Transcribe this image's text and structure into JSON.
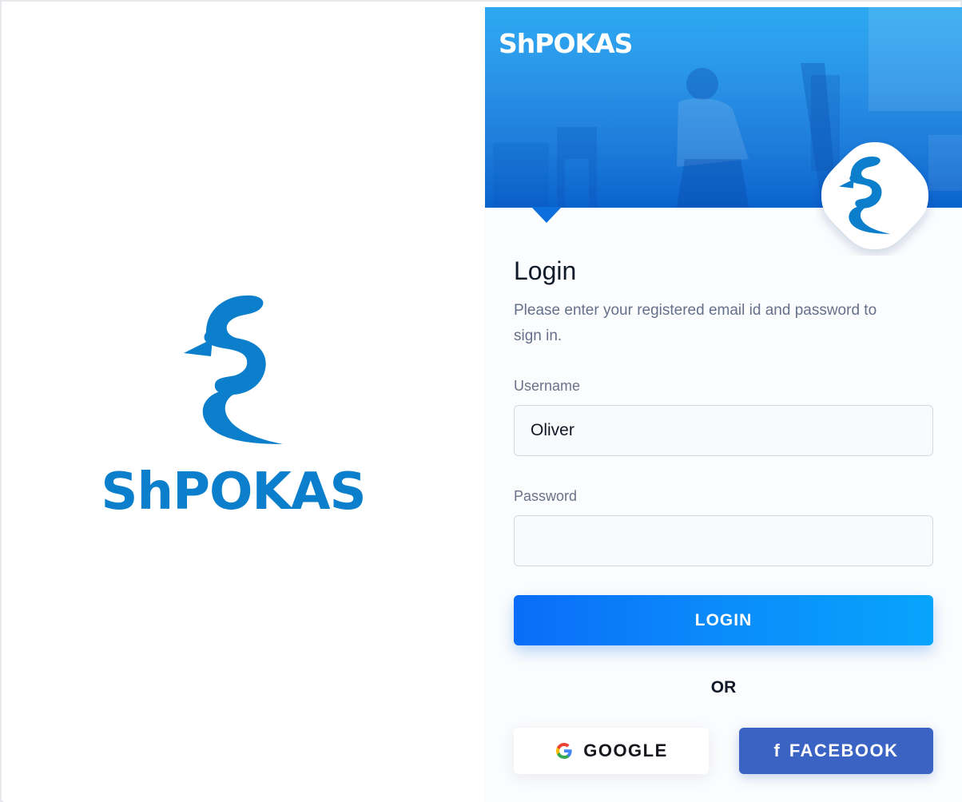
{
  "brand": {
    "name": "ShPOKAS",
    "color": "#0b7fcb"
  },
  "hero": {
    "wordmark": "ShPOKAS"
  },
  "login": {
    "title": "Login",
    "description": "Please enter your registered email id and password to sign in.",
    "username_label": "Username",
    "username_value": "Oliver",
    "password_label": "Password",
    "password_value": "",
    "submit_label": "LOGIN",
    "or_text": "OR"
  },
  "social": {
    "google_label": "GOOGLE",
    "google_icon": "google-icon",
    "facebook_label": "FACEBOOK",
    "facebook_icon": "facebook-icon",
    "facebook_color": "#3a63c3"
  },
  "colors": {
    "primary": "#0a6cf7",
    "accent": "#07a4fb"
  }
}
